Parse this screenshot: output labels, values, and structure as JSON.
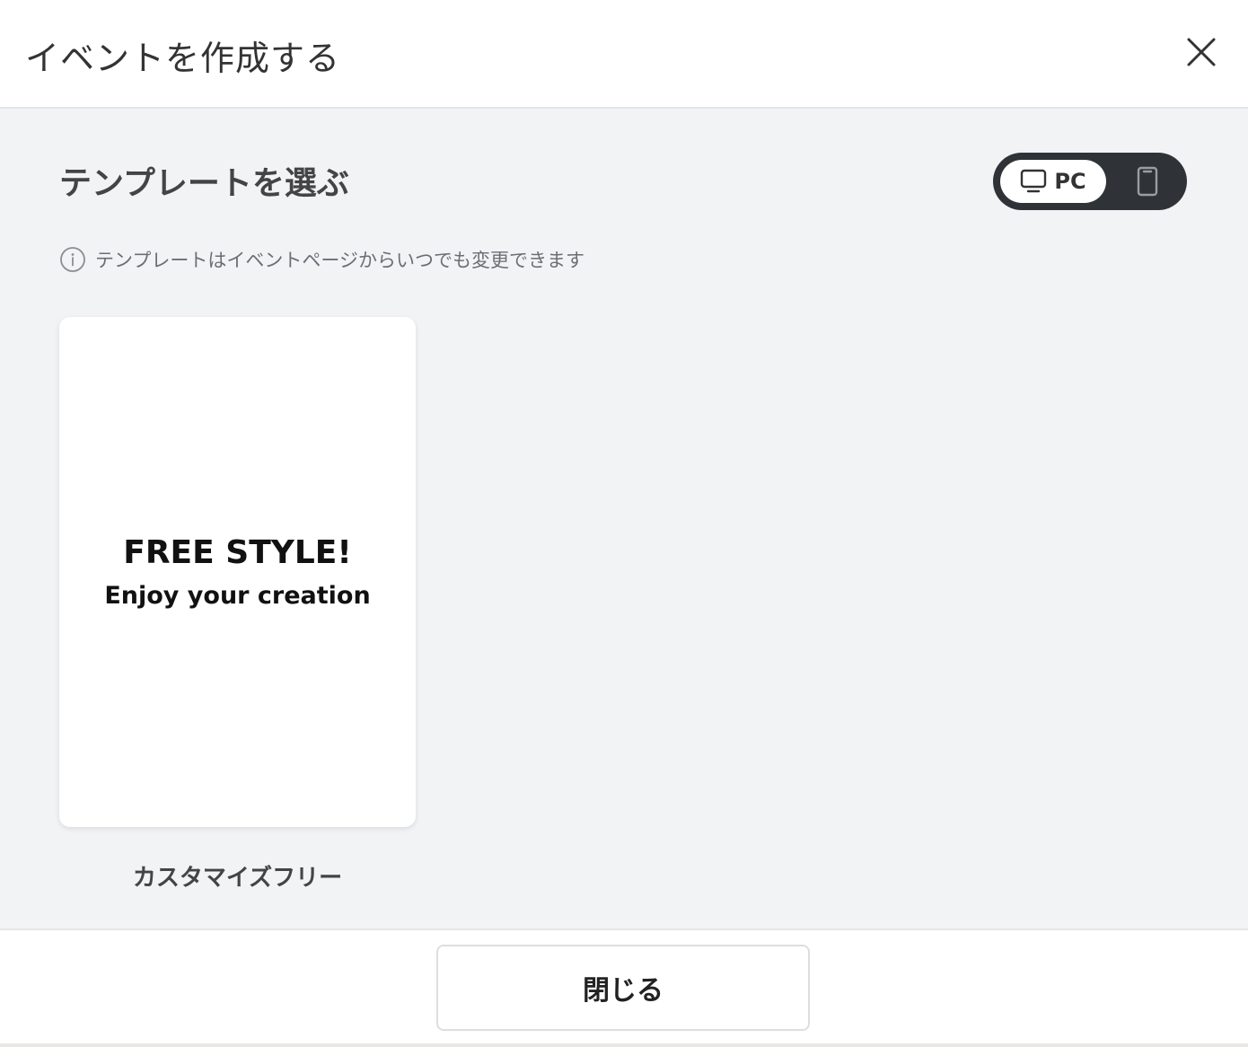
{
  "header": {
    "title": "イベントを作成する",
    "close_icon": "close-icon"
  },
  "main": {
    "section_title": "テンプレートを選ぶ",
    "device_toggle": {
      "selected": "PC",
      "pc_label": "PC",
      "pc_icon": "monitor-icon",
      "mobile_icon": "smartphone-icon"
    },
    "info": {
      "icon": "info-icon",
      "text": "テンプレートはイベントページからいつでも変更できます"
    },
    "templates": [
      {
        "headline": "FREE STYLE!",
        "subheadline": "Enjoy your creation",
        "name": "カスタマイズフリー"
      }
    ]
  },
  "footer": {
    "close_label": "閉じる"
  },
  "colors": {
    "body_background": "#f2f3f5",
    "toggle_background": "#2f3337",
    "text_primary": "#333333",
    "text_muted": "#6b6f74"
  }
}
